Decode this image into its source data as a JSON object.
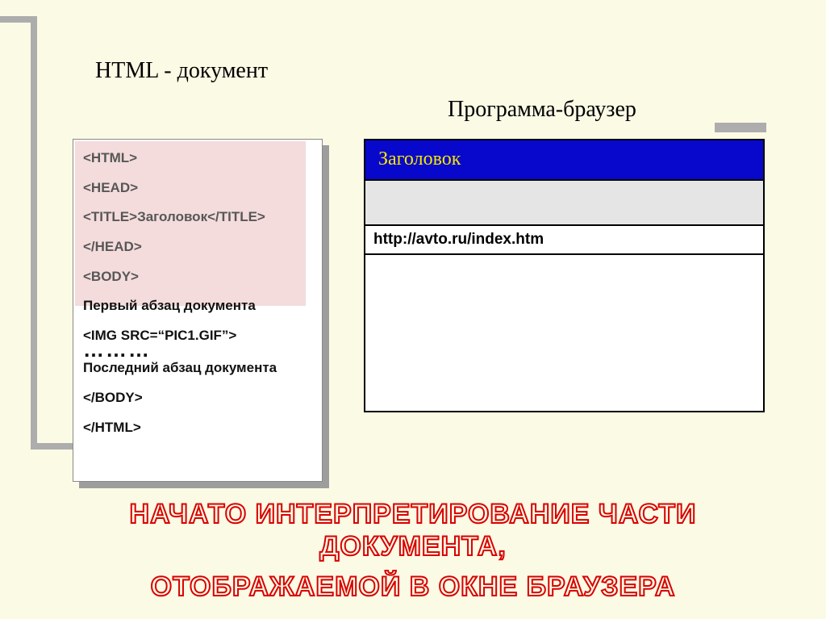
{
  "headings": {
    "doc": "HTML - документ",
    "browser": "Программа-браузер"
  },
  "code": {
    "l1": "<HTML>",
    "l2": "<HEAD>",
    "l3": "<TITLE>Заголовок</TITLE>",
    "l4": "</HEAD>",
    "l5": "<BODY>",
    "l6": "Первый абзац документа",
    "l7": "<IMG SRC=“PIC1.GIF”>",
    "l8": "………",
    "l9": "Последний абзац документа",
    "l10": "</BODY>",
    "l11": "</HTML>"
  },
  "browser": {
    "title": "Заголовок",
    "url": "http://avto.ru/index.htm"
  },
  "headline": {
    "a": "НАЧАТО ИНТЕРПРЕТИРОВАНИЕ ЧАСТИ",
    "b": "ДОКУМЕНТА,",
    "c": "ОТОБРАЖАЕМОЙ В ОКНЕ БРАУЗЕРА"
  }
}
